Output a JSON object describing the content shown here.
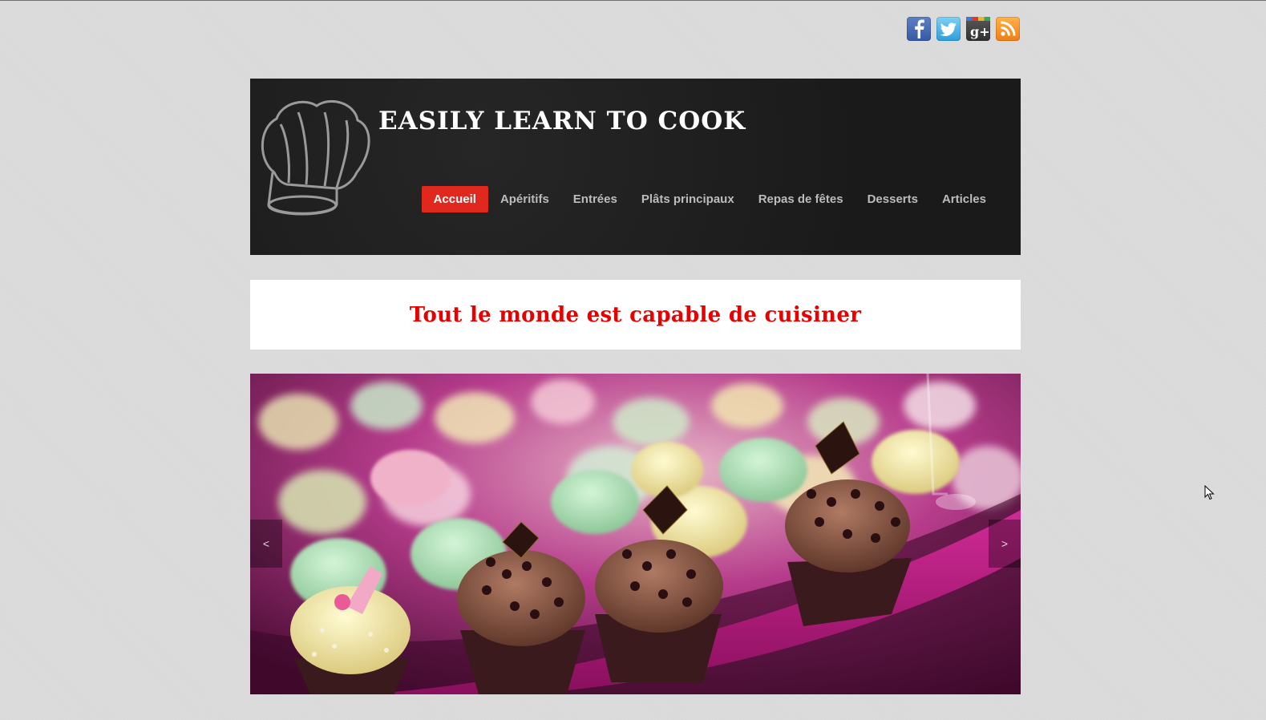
{
  "social": [
    {
      "name": "facebook",
      "icon": "facebook-icon"
    },
    {
      "name": "twitter",
      "icon": "twitter-icon"
    },
    {
      "name": "google-plus",
      "icon": "google-plus-icon"
    },
    {
      "name": "rss",
      "icon": "rss-icon"
    }
  ],
  "header": {
    "title": "EASILY LEARN TO COOK",
    "logo_icon": "chef-hat-icon"
  },
  "nav": {
    "items": [
      "Accueil",
      "Apéritifs",
      "Entrées",
      "Plâts principaux",
      "Repas de fêtes",
      "Desserts",
      "Articles"
    ],
    "active": "Accueil"
  },
  "tagline": "Tout le monde est capable de cuisiner",
  "slider": {
    "image": "cupcakes-slide-image",
    "prev_label": "<",
    "next_label": ">"
  },
  "colors": {
    "accent": "#e0281e",
    "tagline": "#e60000",
    "header_bg": "#1b1b1b",
    "page_bg": "#dadada"
  }
}
